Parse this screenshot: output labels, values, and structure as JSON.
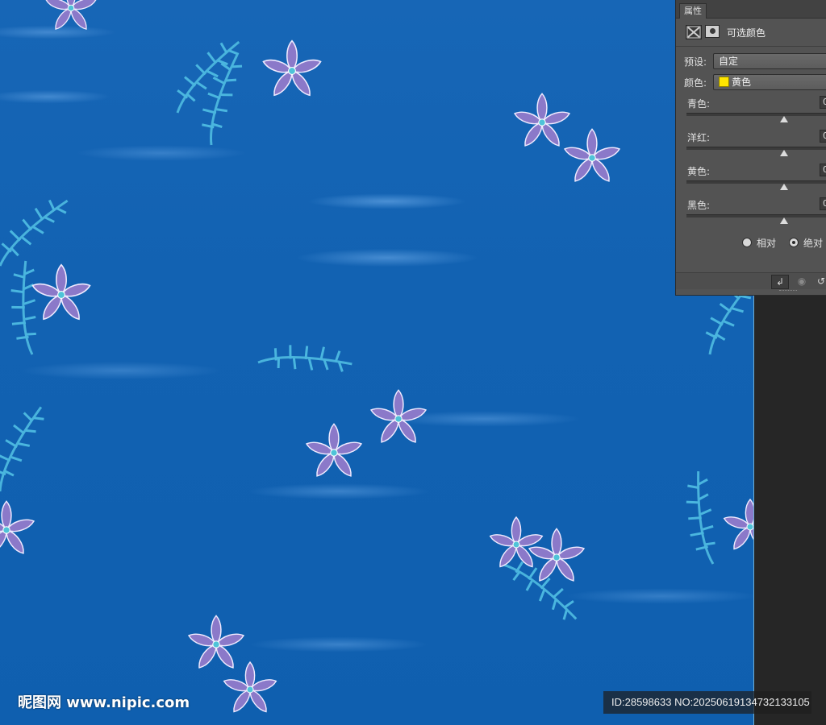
{
  "panel": {
    "tab_label": "属性",
    "title": "可选颜色",
    "preset_label": "预设:",
    "preset_value": "自定",
    "colors_label": "颜色:",
    "colors_value": "黄色",
    "colors_swatch": "#ffe600",
    "sliders": [
      {
        "label": "青色:",
        "value": "0"
      },
      {
        "label": "洋红:",
        "value": "0"
      },
      {
        "label": "黄色:",
        "value": "0"
      },
      {
        "label": "黑色:",
        "value": "0"
      }
    ],
    "method_options": [
      {
        "label": "相对",
        "selected": false
      },
      {
        "label": "绝对",
        "selected": true
      }
    ]
  },
  "watermark": {
    "site": "昵图网 www.nipic.com",
    "id_text": "ID:28598633 NO:20250619134732133105"
  },
  "canvas": {
    "background": "#1262b2",
    "petal": "#8a78c8",
    "leaf": "#49b3dc"
  }
}
